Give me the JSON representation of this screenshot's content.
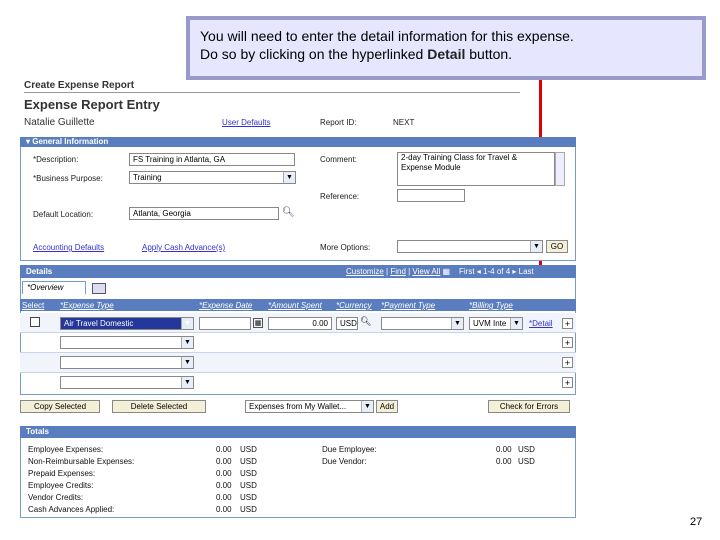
{
  "callout": {
    "line1": "You will need to enter the detail information for this expense.",
    "line2_prefix": "Do so by clicking on the hyperlinked ",
    "line2_bold": "Detail",
    "line2_suffix": " button."
  },
  "page": {
    "title": "Create Expense Report",
    "subtitle": "Expense Report Entry",
    "employee_name": "Natalie Guillette",
    "user_defaults_link": "User Defaults",
    "report_id_label": "Report ID:",
    "report_id_value": "NEXT",
    "slide_number": "27"
  },
  "general": {
    "header": "General Information",
    "description_label": "*Description:",
    "description_value": "FS Training in Atlanta, GA",
    "purpose_label": "*Business Purpose:",
    "purpose_value": "Training",
    "location_label": "Default Location:",
    "location_value": "Atlanta, Georgia",
    "comment_label": "Comment:",
    "comment_value_1": "2-day Training Class for Travel &",
    "comment_value_2": "Expense Module",
    "reference_label": "Reference:",
    "accounting_link": "Accounting Defaults",
    "cash_advance_link": "Apply Cash Advance(s)",
    "more_options_label": "More Options:",
    "go_button": "GO"
  },
  "details": {
    "header": "Details",
    "customize": "Customize",
    "find": "Find",
    "view_all": "View All",
    "first": "First",
    "range": "1-4 of 4",
    "last": "Last",
    "tab_overview": "*Overview",
    "columns": [
      "Select",
      "*Expense Type",
      "*Expense Date",
      "*Amount Spent",
      "*Currency",
      "*Payment Type",
      "*Billing Type"
    ],
    "row1": {
      "expense_type": "Air Travel Domestic",
      "amount": "0.00",
      "currency": "USD",
      "billing": "UVM Inte",
      "detail_link": "*Detail"
    },
    "copy_button": "Copy Selected",
    "delete_button": "Delete Selected",
    "wallet_select": "Expenses from My Wallet...",
    "add_button": "Add",
    "check_errors_button": "Check for Errors"
  },
  "totals": {
    "header": "Totals",
    "left": [
      {
        "label": "Employee Expenses:",
        "amount": "0.00",
        "currency": "USD"
      },
      {
        "label": "Non-Reimbursable Expenses:",
        "amount": "0.00",
        "currency": "USD"
      },
      {
        "label": "Prepaid Expenses:",
        "amount": "0.00",
        "currency": "USD"
      },
      {
        "label": "Employee Credits:",
        "amount": "0.00",
        "currency": "USD"
      },
      {
        "label": "Vendor Credits:",
        "amount": "0.00",
        "currency": "USD"
      },
      {
        "label": "Cash Advances Applied:",
        "amount": "0.00",
        "currency": "USD"
      }
    ],
    "right": [
      {
        "label": "Due Employee:",
        "amount": "0.00",
        "currency": "USD"
      },
      {
        "label": "Due Vendor:",
        "amount": "0.00",
        "currency": "USD"
      }
    ]
  },
  "colors": {
    "accent": "#5a7dbf",
    "arrow": "#e00000",
    "callout_bg": "#e6e6ff"
  }
}
